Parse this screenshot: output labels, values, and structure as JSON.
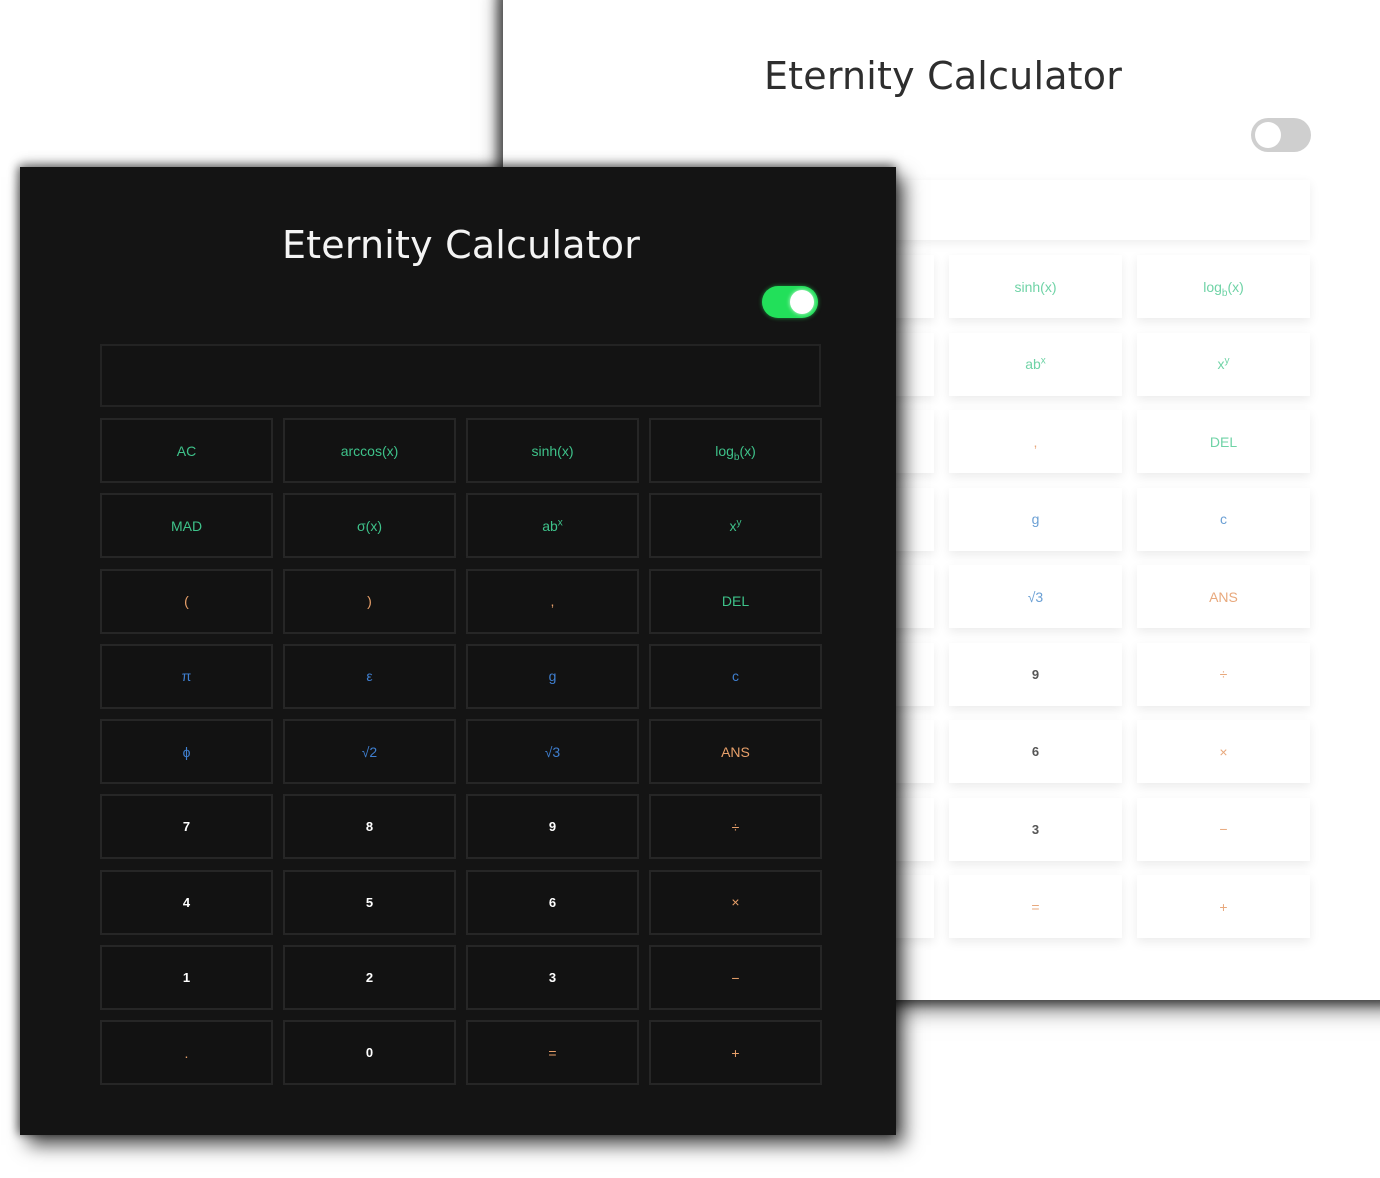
{
  "app_title": "Eternity Calculator",
  "theme_toggle": {
    "dark_state": "on",
    "light_state": "off"
  },
  "colors": {
    "function_green": "#3ec28a",
    "operator_orange": "#e8a06a",
    "constant_blue": "#3f7fd0",
    "number_white": "#ffffff",
    "toggle_on": "#22e05a",
    "toggle_off": "#cfcfcf",
    "dark_bg": "#141414",
    "light_bg": "#ffffff"
  },
  "display": {
    "value": ""
  },
  "dark_calculator": {
    "title": "Eternity Calculator",
    "buttons": [
      {
        "label": "AC",
        "kind": "fn"
      },
      {
        "label": "arccos(x)",
        "kind": "fn"
      },
      {
        "label": "sinh(x)",
        "kind": "fn"
      },
      {
        "base": "log",
        "sub": "b",
        "tail": "(x)",
        "kind": "fn"
      },
      {
        "label": "MAD",
        "kind": "fn"
      },
      {
        "label": "σ(x)",
        "kind": "fn"
      },
      {
        "base": "ab",
        "sup": "x",
        "kind": "fn"
      },
      {
        "base": "x",
        "sup": "y",
        "kind": "fn"
      },
      {
        "label": "(",
        "kind": "op"
      },
      {
        "label": ")",
        "kind": "op"
      },
      {
        "label": ",",
        "kind": "op"
      },
      {
        "label": "DEL",
        "kind": "fn"
      },
      {
        "label": "π",
        "kind": "const"
      },
      {
        "label": "ε",
        "kind": "const"
      },
      {
        "label": "g",
        "kind": "const"
      },
      {
        "label": "c",
        "kind": "const"
      },
      {
        "label": "ϕ",
        "kind": "const"
      },
      {
        "label": "√2",
        "kind": "const"
      },
      {
        "label": "√3",
        "kind": "const"
      },
      {
        "label": "ANS",
        "kind": "op"
      },
      {
        "label": "7",
        "kind": "num"
      },
      {
        "label": "8",
        "kind": "num"
      },
      {
        "label": "9",
        "kind": "num"
      },
      {
        "label": "÷",
        "kind": "op"
      },
      {
        "label": "4",
        "kind": "num"
      },
      {
        "label": "5",
        "kind": "num"
      },
      {
        "label": "6",
        "kind": "num"
      },
      {
        "label": "×",
        "kind": "op"
      },
      {
        "label": "1",
        "kind": "num"
      },
      {
        "label": "2",
        "kind": "num"
      },
      {
        "label": "3",
        "kind": "num"
      },
      {
        "label": "−",
        "kind": "op"
      },
      {
        "label": ".",
        "kind": "op"
      },
      {
        "label": "0",
        "kind": "num"
      },
      {
        "label": "=",
        "kind": "op"
      },
      {
        "label": "+",
        "kind": "op"
      }
    ]
  },
  "light_calculator": {
    "title": "Eternity Calculator",
    "visible_buttons": [
      {
        "label": "sinh(x)",
        "kind": "fn"
      },
      {
        "base": "log",
        "sub": "b",
        "tail": "(x)",
        "kind": "fn"
      },
      {
        "base": "ab",
        "sup": "x",
        "kind": "fn"
      },
      {
        "base": "x",
        "sup": "y",
        "kind": "fn"
      },
      {
        "label": ",",
        "kind": "op"
      },
      {
        "label": "DEL",
        "kind": "fn"
      },
      {
        "label": "g",
        "kind": "const"
      },
      {
        "label": "c",
        "kind": "const"
      },
      {
        "label": "√3",
        "kind": "const"
      },
      {
        "label": "ANS",
        "kind": "op"
      },
      {
        "label": "9",
        "kind": "num"
      },
      {
        "label": "÷",
        "kind": "op"
      },
      {
        "label": "6",
        "kind": "num"
      },
      {
        "label": "×",
        "kind": "op"
      },
      {
        "label": "3",
        "kind": "num"
      },
      {
        "label": "−",
        "kind": "op"
      },
      {
        "label": "=",
        "kind": "op"
      },
      {
        "label": "+",
        "kind": "op"
      }
    ]
  }
}
